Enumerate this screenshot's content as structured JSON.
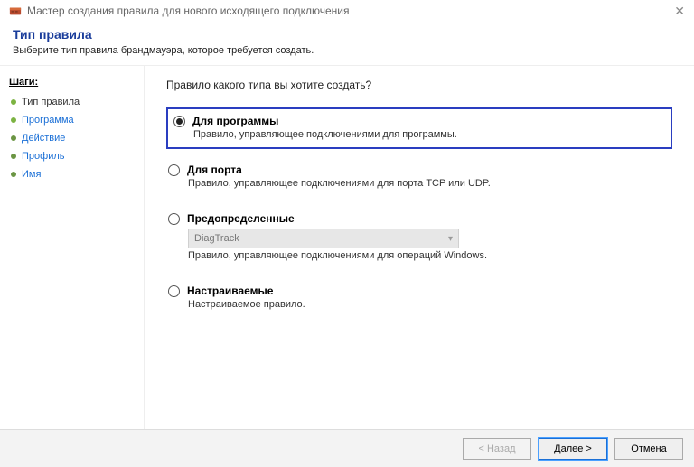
{
  "window": {
    "title": "Мастер создания правила для нового исходящего подключения"
  },
  "header": {
    "title": "Тип правила",
    "subtitle": "Выберите тип правила брандмауэра, которое требуется создать."
  },
  "sidebar": {
    "steps_label": "Шаги:",
    "steps": [
      {
        "label": "Тип правила"
      },
      {
        "label": "Программа"
      },
      {
        "label": "Действие"
      },
      {
        "label": "Профиль"
      },
      {
        "label": "Имя"
      }
    ]
  },
  "main": {
    "question": "Правило какого типа вы хотите создать?",
    "options": [
      {
        "value": "program",
        "title": "Для программы",
        "desc": "Правило, управляющее подключениями для программы.",
        "checked": true,
        "highlighted": true
      },
      {
        "value": "port",
        "title": "Для порта",
        "desc": "Правило, управляющее подключениями для порта TCP или UDP."
      },
      {
        "value": "predefined",
        "title": "Предопределенные",
        "dropdown_value": "DiagTrack",
        "desc": "Правило, управляющее подключениями для операций Windows."
      },
      {
        "value": "custom",
        "title": "Настраиваемые",
        "desc": "Настраиваемое правило."
      }
    ]
  },
  "footer": {
    "back": "< Назад",
    "next": "Далее >",
    "cancel": "Отмена"
  }
}
